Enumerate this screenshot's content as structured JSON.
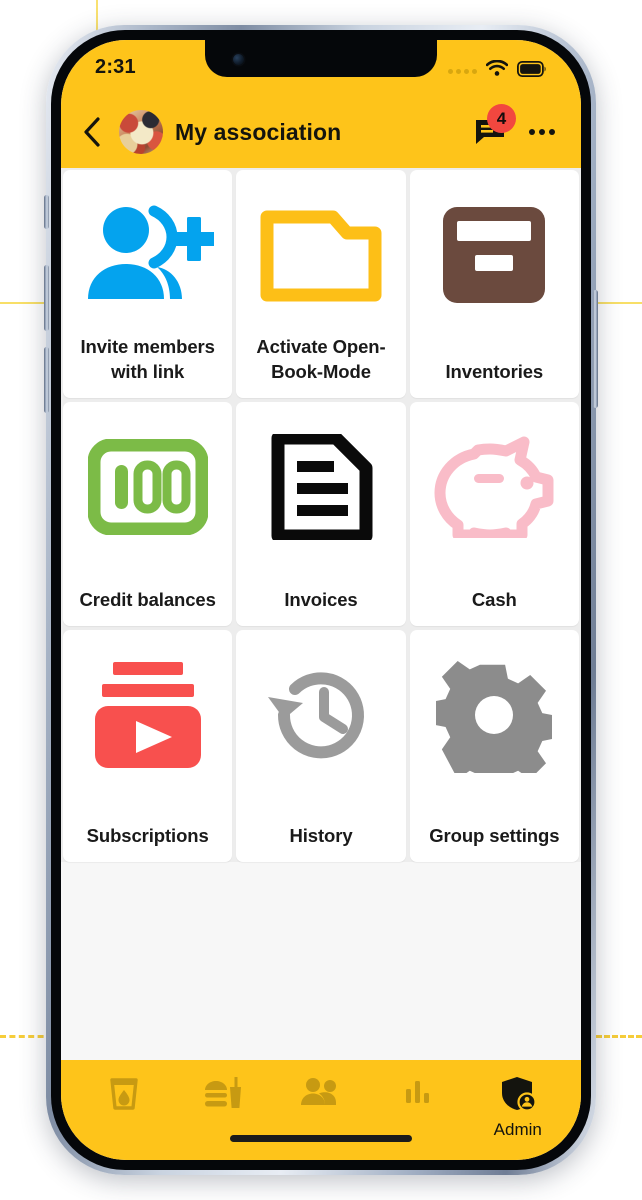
{
  "theme": {
    "brand_yellow": "#FEC41A",
    "screen_bg": "#f7f7f7",
    "tile_bg": "#ffffff",
    "badge_red": "#F2473F",
    "text_dark": "#1a1a1a",
    "nav_icon_inactive": "#c79a12",
    "nav_icon_active": "#14140e"
  },
  "status_bar": {
    "time": "2:31",
    "signal_icon": "signal-dots-icon",
    "wifi_icon": "wifi-icon",
    "battery_icon": "battery-full-icon"
  },
  "app_bar": {
    "back_icon": "chevron-left-icon",
    "avatar_icon": "group-avatar-photo",
    "title": "My association",
    "chat_icon": "chat-bubble-icon",
    "chat_badge_count": "4",
    "more_icon": "more-horizontal-icon"
  },
  "grid": {
    "tiles": [
      {
        "label": "Invite members with link",
        "icon": "person-add-icon",
        "color": "#04A3EE"
      },
      {
        "label": "Activate Open-Book-Mode",
        "icon": "open-folder-icon",
        "color": "#FDBF17"
      },
      {
        "label": "Inventories",
        "icon": "storage-box-icon",
        "color": "#6B4A3E"
      },
      {
        "label": "Credit balances",
        "icon": "hundred-banknote-icon",
        "color": "#7CBB47"
      },
      {
        "label": "Invoices",
        "icon": "document-lines-icon",
        "color": "#0A0A0A"
      },
      {
        "label": "Cash",
        "icon": "piggy-bank-icon",
        "color": "#F9BCC8"
      },
      {
        "label": "Subscriptions",
        "icon": "subscriptions-play-icon",
        "color": "#F8504E"
      },
      {
        "label": "History",
        "icon": "history-clock-icon",
        "color": "#9B9B9B"
      },
      {
        "label": "Group settings",
        "icon": "gear-icon",
        "color": "#8C8C8C"
      }
    ]
  },
  "bottom_nav": {
    "items": [
      {
        "label": "",
        "icon": "drink-glass-icon",
        "active": false
      },
      {
        "label": "",
        "icon": "fast-food-icon",
        "active": false
      },
      {
        "label": "",
        "icon": "people-group-icon",
        "active": false
      },
      {
        "label": "",
        "icon": "bar-chart-icon",
        "active": false
      },
      {
        "label": "Admin",
        "icon": "admin-shield-icon",
        "active": true
      }
    ]
  }
}
